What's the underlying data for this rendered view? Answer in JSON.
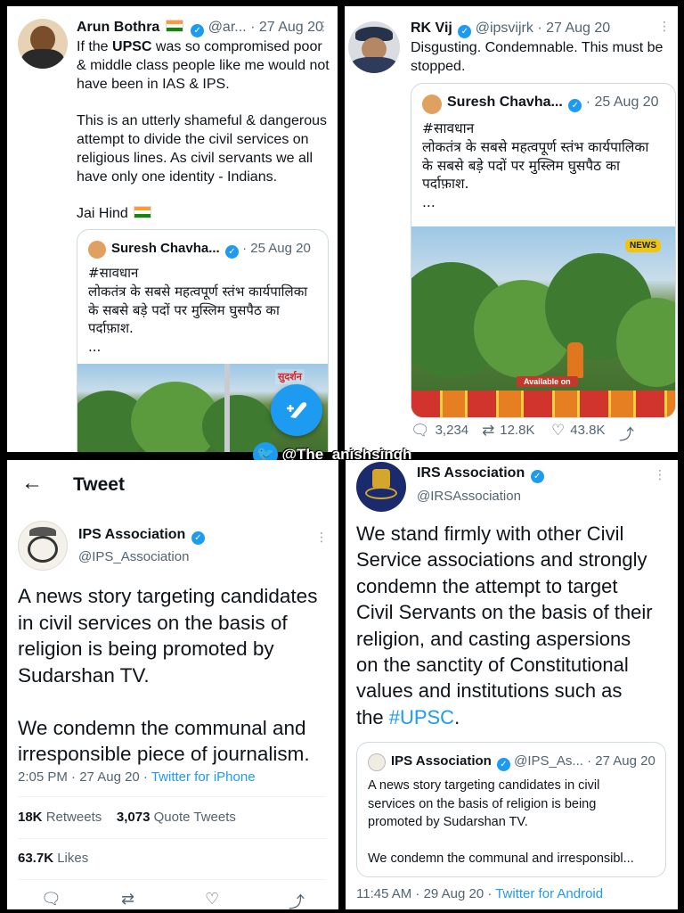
{
  "p1": {
    "name": "Arun Bothra",
    "handle": "@ar...",
    "date": "· 27 Aug 20",
    "line1_pre": "If the ",
    "line1_bold": "UPSC",
    "line1_post": " was so compromised poor",
    "line2": "& middle class people like me would not",
    "line3": "have been in IAS & IPS.",
    "para2": [
      "This is an utterly shameful & dangerous",
      "attempt to divide the civil services on",
      "religious lines. As civil servants we all",
      "have only one identity - Indians."
    ],
    "jai": "Jai Hind",
    "quote": {
      "name": "Suresh Chavha...",
      "date": "· 25 Aug 20",
      "lines": [
        "#सावधान",
        "लोकतंत्र के सबसे महत्वपूर्ण स्तंभ कार्यपालिका",
        "के सबसे बड़े पदों पर मुस्लिम घुसपैठ का",
        "पर्दाफ़ाश.",
        "..."
      ],
      "channel_logo": "सुदर्शन"
    }
  },
  "p2": {
    "name": "RK Vij",
    "handle": "@ipsvijrk",
    "date": "· 27 Aug 20",
    "text": [
      "Disgusting. Condemnable. This must be",
      "stopped."
    ],
    "quote": {
      "name": "Suresh Chavha...",
      "date": "· 25 Aug 20",
      "lines": [
        "#सावधान",
        "लोकतंत्र के सबसे महत्वपूर्ण स्तंभ कार्यपालिका",
        "के सबसे बड़े पदों पर मुस्लिम घुसपैठ का",
        "पर्दाफ़ाश.",
        "..."
      ],
      "banner": "Available on",
      "channel_logo": "NEWS"
    },
    "replies": "3,234",
    "retweets": "12.8K",
    "likes": "43.8K"
  },
  "watermark": "@The_anishsingh",
  "p3": {
    "header": "Tweet",
    "name": "IPS Association",
    "handle": "@IPS_Association",
    "text": [
      "A news story targeting candidates",
      "in civil services on the basis of",
      "religion is being promoted by",
      "Sudarshan TV."
    ],
    "text2": [
      "We condemn the communal and",
      "irresponsible piece of journalism."
    ],
    "meta": "2:05 PM · 27 Aug 20 · ",
    "source": "Twitter for iPhone",
    "retweets_count": "18K",
    "retweets_label": "Retweets",
    "quotes_count": "3,073",
    "quotes_label": "Quote Tweets",
    "likes_count": "63.7K",
    "likes_label": "Likes"
  },
  "p4": {
    "name": "IRS Association",
    "handle": "@IRSAssociation",
    "text": [
      "We stand firmly with other Civil",
      "Service associations and strongly",
      "condemn the attempt to target",
      "Civil Servants on the basis of their",
      "religion, and casting aspersions",
      "on the sanctity of Constitutional",
      "values and institutions such as"
    ],
    "last_pre": "the ",
    "last_link": "#UPSC",
    "last_post": ".",
    "quote": {
      "name": "IPS Association",
      "handle": "@IPS_As...",
      "date": "· 27 Aug 20",
      "lines": [
        "A news story targeting candidates in civil",
        "services on the basis of religion is being",
        "promoted by Sudarshan TV."
      ],
      "line2": "We condemn the communal and irresponsibl..."
    },
    "meta": "11:45 AM · 29 Aug 20 · ",
    "source": "Twitter for Android"
  },
  "colors": {
    "link_blue": "#1d9bf0",
    "gray_text": "#536471",
    "fab_blue": "#1d9bf0",
    "border": "#cfd9de"
  },
  "icons": [
    "more-dots-icon",
    "verified-badge-icon",
    "india-flag-icon",
    "compose-icon",
    "reply-icon",
    "retweet-icon",
    "like-icon",
    "share-icon",
    "back-arrow-icon",
    "twitter-bird-icon"
  ]
}
